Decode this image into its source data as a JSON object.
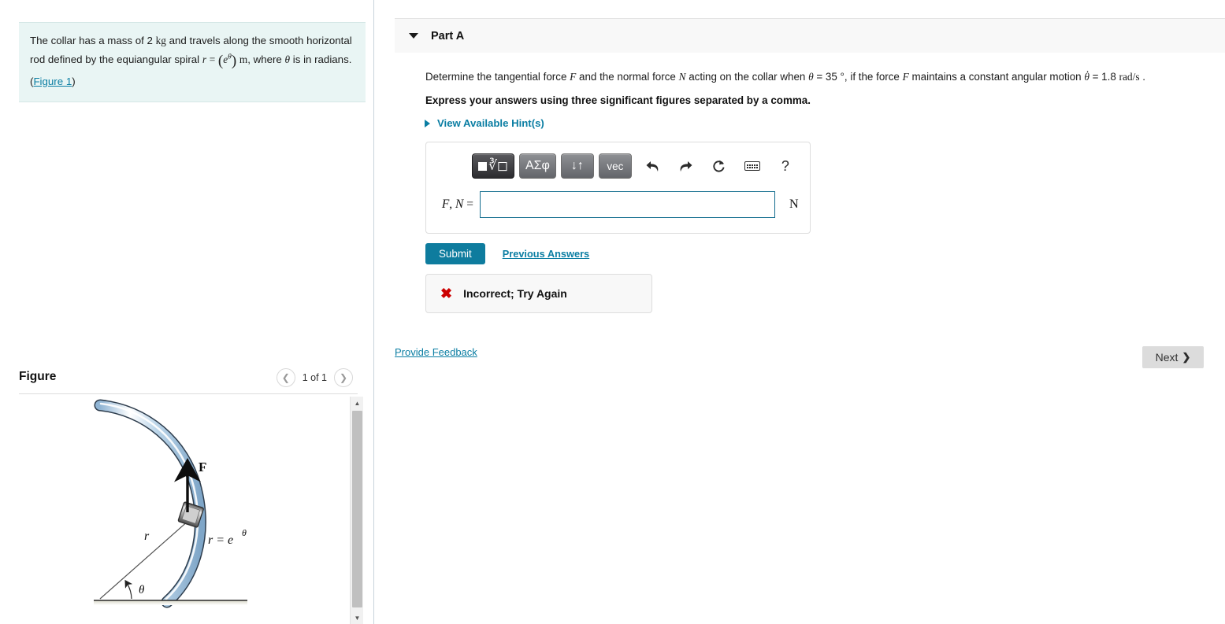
{
  "problem": {
    "text_1": "The collar has a mass of 2 ",
    "unit_mass": "kg",
    "text_2": " and travels along the smooth horizontal rod defined by the equiangular spiral ",
    "eq_r": "r",
    "eq_equals": "=",
    "eq_e": "e",
    "eq_theta_exp": "θ",
    "unit_m": "m",
    "text_3": ", where ",
    "theta_sym": "θ",
    "text_4": " is in radians. (",
    "figure_link": "Figure 1",
    "text_5": ")"
  },
  "figure": {
    "title": "Figure",
    "prev_icon": "chevron-left-icon",
    "next_icon": "chevron-right-icon",
    "counter": "1 of 1",
    "labels": {
      "force": "F",
      "radius": "r",
      "angle": "θ",
      "curve_eq_lhs": "r",
      "curve_eq_rel": "=",
      "curve_eq_base": "e",
      "curve_eq_exp": "θ"
    },
    "scrollbar": {
      "up_icon": "triangle-up-icon",
      "down_icon": "triangle-down-icon"
    }
  },
  "part": {
    "collapse_icon": "caret-down-icon",
    "label": "Part A",
    "question": {
      "seg_1": "Determine the tangential force ",
      "var_F": "F",
      "seg_2": " and the normal force ",
      "var_N": "N",
      "seg_3": " acting on the collar when ",
      "var_theta": "θ",
      "seg_4": " = 35 ",
      "deg": "°",
      "seg_5": ", if the force ",
      "var_F2": "F",
      "seg_6": " maintains a constant angular motion ",
      "var_thetadot": "θ",
      "seg_7": " = 1.8 ",
      "unit_rads": "rad/s",
      "seg_8": " ."
    },
    "express": "Express your answers using three significant figures separated by a comma.",
    "hints_icon": "caret-right-icon",
    "hints_label": "View Available Hint(s)"
  },
  "mathbar": {
    "buttons": [
      {
        "name": "template-radical-button",
        "label": "√",
        "square": true
      },
      {
        "name": "greek-symbols-button",
        "label": "ΑΣφ"
      },
      {
        "name": "updown-arrows-button",
        "label": "↓↑"
      },
      {
        "name": "vector-button",
        "label": "vec"
      }
    ],
    "icons": [
      {
        "name": "undo-icon",
        "glyph": "↰"
      },
      {
        "name": "redo-icon",
        "glyph": "↱"
      },
      {
        "name": "reset-icon",
        "glyph": "↻"
      },
      {
        "name": "keyboard-icon",
        "glyph": ""
      },
      {
        "name": "help-icon",
        "glyph": "?"
      }
    ]
  },
  "answer": {
    "label_F": "F",
    "label_comma": ",",
    "label_N": "N",
    "label_equals": "=",
    "value": "",
    "placeholder": "",
    "unit": "N"
  },
  "actions": {
    "submit_label": "Submit",
    "previous_answers_label": "Previous Answers"
  },
  "feedback": {
    "icon": "x-mark-icon",
    "message": "Incorrect; Try Again"
  },
  "footer": {
    "provide_feedback_label": "Provide Feedback",
    "next_label": "Next",
    "next_icon": "chevron-right-icon"
  },
  "colors": {
    "accent": "#0b7ea3",
    "submit": "#0e7c9e",
    "problem_bg": "#e9f5f4",
    "error": "#cc0000",
    "input_border": "#136d8e"
  }
}
